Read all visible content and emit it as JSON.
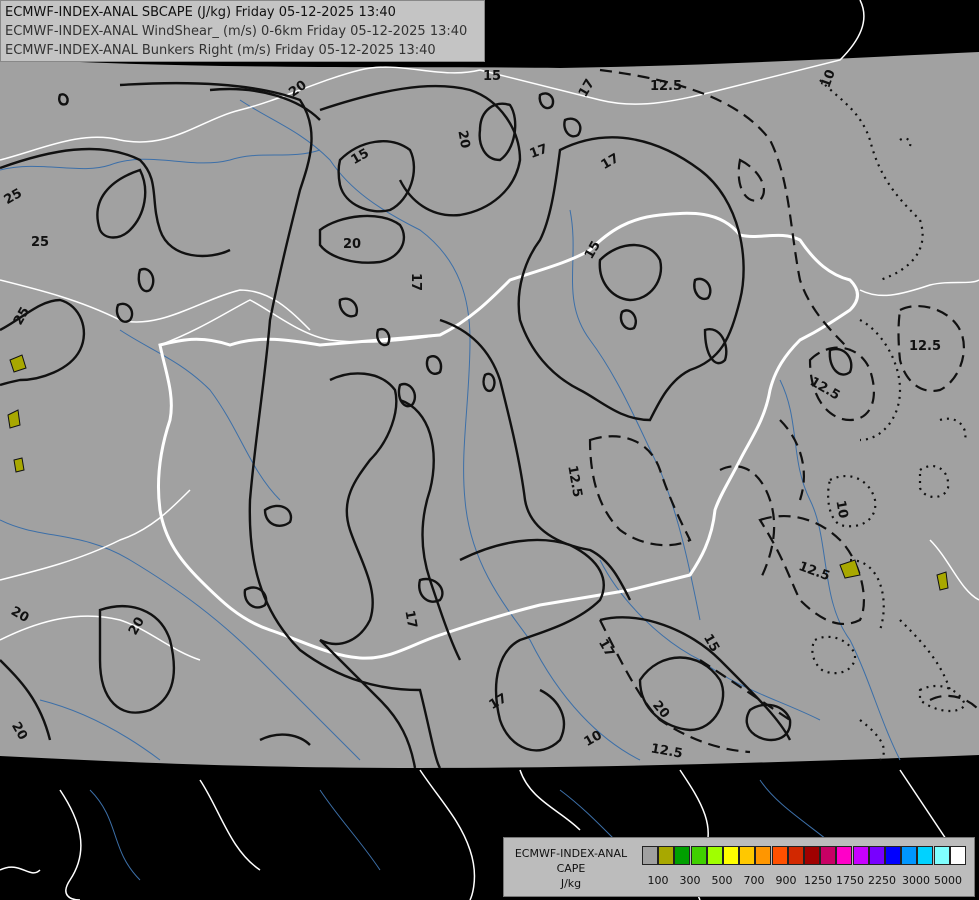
{
  "header": {
    "line1": "ECMWF-INDEX-ANAL SBCAPE (J/kg) Friday 05-12-2025 13:40",
    "line2": "ECMWF-INDEX-ANAL WindShear_ (m/s) 0-6km Friday 05-12-2025 13:40",
    "line3": "ECMWF-INDEX-ANAL Bunkers Right (m/s) Friday 05-12-2025 13:40"
  },
  "legend": {
    "title1": "ECMWF-INDEX-ANAL",
    "title2": "CAPE",
    "units": "J/kg",
    "swatches": [
      "#a0a0a0",
      "#a8a800",
      "#00a000",
      "#40d000",
      "#a0ff00",
      "#ffff00",
      "#ffc800",
      "#ff9600",
      "#ff5000",
      "#d22800",
      "#a00000",
      "#c80064",
      "#ff00c8",
      "#c800ff",
      "#7800ff",
      "#0000ff",
      "#0096ff",
      "#00d2ff",
      "#80ffff",
      "#ffffff"
    ],
    "ticks": [
      "100",
      "300",
      "500",
      "700",
      "900",
      "1250",
      "1750",
      "2250",
      "3000",
      "5000"
    ]
  },
  "contour_labels": [
    {
      "text": "20"
    },
    {
      "text": "15"
    },
    {
      "text": "25"
    },
    {
      "text": "25"
    },
    {
      "text": "25"
    },
    {
      "text": "20"
    },
    {
      "text": "17"
    },
    {
      "text": "20"
    },
    {
      "text": "15"
    },
    {
      "text": "17"
    },
    {
      "text": "17"
    },
    {
      "text": "15"
    },
    {
      "text": "17"
    },
    {
      "text": "12.5"
    },
    {
      "text": "10"
    },
    {
      "text": "12.5"
    },
    {
      "text": "12.5"
    },
    {
      "text": "12.5"
    },
    {
      "text": "10"
    },
    {
      "text": "12.5"
    },
    {
      "text": "17"
    },
    {
      "text": "20"
    },
    {
      "text": "20"
    },
    {
      "text": "20"
    },
    {
      "text": "17"
    },
    {
      "text": "17"
    },
    {
      "text": "15"
    },
    {
      "text": "20"
    },
    {
      "text": "10"
    },
    {
      "text": "12.5"
    }
  ]
}
